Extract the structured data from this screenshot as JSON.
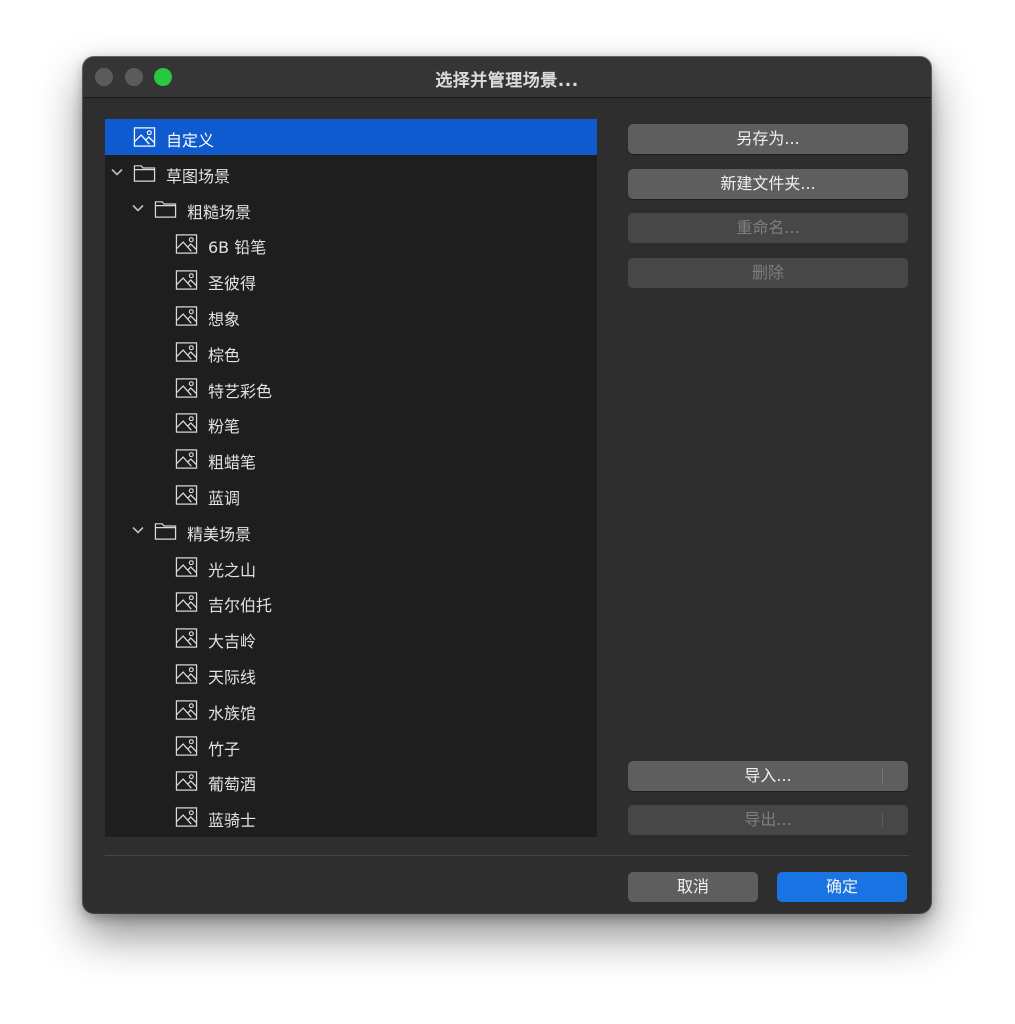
{
  "window": {
    "title": "选择并管理场景..."
  },
  "tree": {
    "rows": [
      {
        "label": "自定义",
        "type": "item",
        "depth": 0,
        "expanded": null,
        "selected": true
      },
      {
        "label": "草图场景",
        "type": "folder",
        "depth": 0,
        "expanded": true,
        "selected": false
      },
      {
        "label": "粗糙场景",
        "type": "folder",
        "depth": 1,
        "expanded": true,
        "selected": false
      },
      {
        "label": "6B 铅笔",
        "type": "item",
        "depth": 2,
        "expanded": null,
        "selected": false
      },
      {
        "label": "圣彼得",
        "type": "item",
        "depth": 2,
        "expanded": null,
        "selected": false
      },
      {
        "label": "想象",
        "type": "item",
        "depth": 2,
        "expanded": null,
        "selected": false
      },
      {
        "label": "棕色",
        "type": "item",
        "depth": 2,
        "expanded": null,
        "selected": false
      },
      {
        "label": "特艺彩色",
        "type": "item",
        "depth": 2,
        "expanded": null,
        "selected": false
      },
      {
        "label": "粉笔",
        "type": "item",
        "depth": 2,
        "expanded": null,
        "selected": false
      },
      {
        "label": "粗蜡笔",
        "type": "item",
        "depth": 2,
        "expanded": null,
        "selected": false
      },
      {
        "label": "蓝调",
        "type": "item",
        "depth": 2,
        "expanded": null,
        "selected": false
      },
      {
        "label": "精美场景",
        "type": "folder",
        "depth": 1,
        "expanded": true,
        "selected": false
      },
      {
        "label": "光之山",
        "type": "item",
        "depth": 2,
        "expanded": null,
        "selected": false
      },
      {
        "label": "吉尔伯托",
        "type": "item",
        "depth": 2,
        "expanded": null,
        "selected": false
      },
      {
        "label": "大吉岭",
        "type": "item",
        "depth": 2,
        "expanded": null,
        "selected": false
      },
      {
        "label": "天际线",
        "type": "item",
        "depth": 2,
        "expanded": null,
        "selected": false
      },
      {
        "label": "水族馆",
        "type": "item",
        "depth": 2,
        "expanded": null,
        "selected": false
      },
      {
        "label": "竹子",
        "type": "item",
        "depth": 2,
        "expanded": null,
        "selected": false
      },
      {
        "label": "葡萄酒",
        "type": "item",
        "depth": 2,
        "expanded": null,
        "selected": false
      },
      {
        "label": "蓝骑士",
        "type": "item",
        "depth": 2,
        "expanded": null,
        "selected": false
      }
    ]
  },
  "actions": {
    "save_as": {
      "label": "另存为...",
      "enabled": true
    },
    "new_folder": {
      "label": "新建文件夹...",
      "enabled": true
    },
    "rename": {
      "label": "重命名...",
      "enabled": false
    },
    "delete": {
      "label": "删除",
      "enabled": false
    },
    "import": {
      "label": "导入...",
      "enabled": true
    },
    "export": {
      "label": "导出...",
      "enabled": false
    }
  },
  "footer": {
    "cancel_label": "取消",
    "ok_label": "确定"
  },
  "colors": {
    "selection": "#0f5acf",
    "primary_button": "#1a73e2",
    "zoom_button": "#2ac840"
  }
}
